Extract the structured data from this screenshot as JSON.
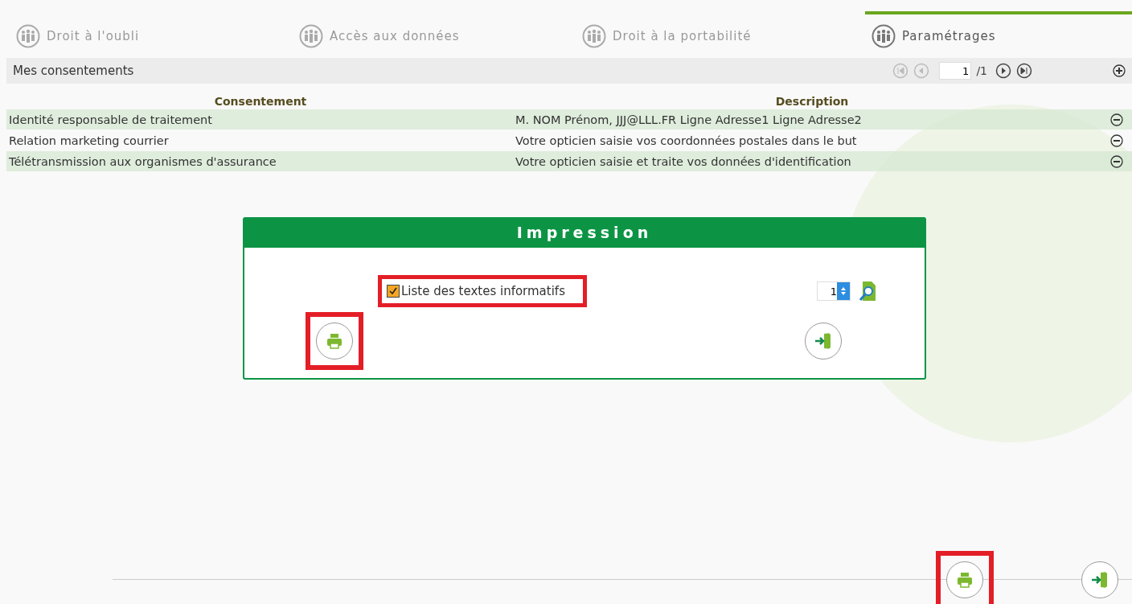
{
  "tabs": [
    {
      "label": "Droit à l'oubli",
      "selected": false
    },
    {
      "label": "Accès aux données",
      "selected": false
    },
    {
      "label": "Droit à la portabilité",
      "selected": false
    },
    {
      "label": "Paramétrages",
      "selected": true
    }
  ],
  "section": {
    "title": "Mes consentements",
    "pager": {
      "page": "1",
      "total": "/1"
    }
  },
  "table": {
    "columns": [
      "Consentement",
      "Description"
    ],
    "rows": [
      {
        "cells": [
          "Identité responsable de traitement",
          "M. NOM Prénom, JJJ@LLL.FR Ligne Adresse1 Ligne Adresse2"
        ]
      },
      {
        "cells": [
          "Relation marketing courrier",
          "Votre opticien saisie vos coordonnées postales dans le but"
        ]
      },
      {
        "cells": [
          "Télétransmission aux organismes d'assurance",
          "Votre opticien saisie et traite vos données d'identification"
        ]
      }
    ]
  },
  "dialog": {
    "title": "Impression",
    "option": {
      "label": "Liste des textes informatifs",
      "checked": true,
      "highlighted": true
    },
    "copies": "1",
    "print_highlighted": true
  },
  "footer": {
    "print_highlighted": true
  }
}
